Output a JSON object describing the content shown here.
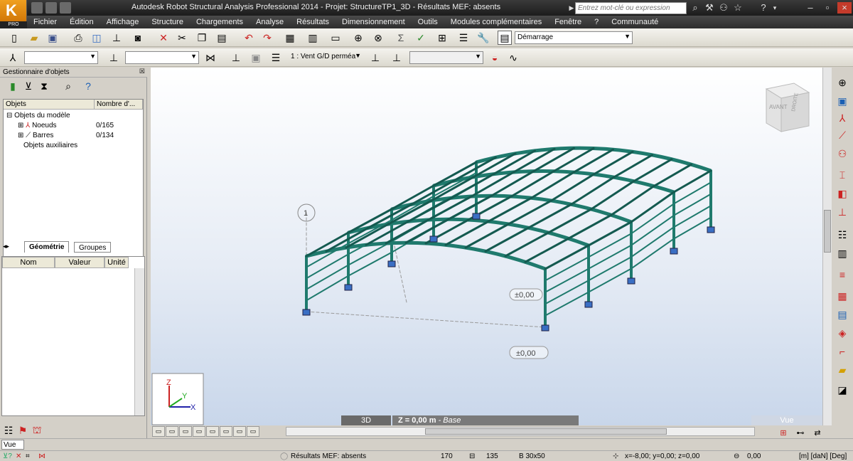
{
  "app": {
    "title": "Autodesk Robot Structural Analysis Professional 2014 - Projet: StructureTP1_3D - Résultats MEF: absents",
    "logo_letter": "K",
    "logo_badge": "PRO"
  },
  "search": {
    "placeholder": "Entrez mot-clé ou expression"
  },
  "menu": [
    "Fichier",
    "Édition",
    "Affichage",
    "Structure",
    "Chargements",
    "Analyse",
    "Résultats",
    "Dimensionnement",
    "Outils",
    "Modules complémentaires",
    "Fenêtre",
    "?",
    "Communauté"
  ],
  "toolbar1": {
    "layout_select": "Démarrage"
  },
  "toolbar2": {
    "case_select": "1 : Vent G/D perméa",
    "node_select": "",
    "bar_select": "",
    "extra_select": ""
  },
  "object_manager": {
    "title": "Gestionnaire d'objets",
    "col_objects": "Objets",
    "col_count": "Nombre d'...",
    "model_objects": "Objets du modèle",
    "nodes_label": "Noeuds",
    "nodes_count": "0/165",
    "bars_label": "Barres",
    "bars_count": "0/134",
    "aux_objects": "Objets auxiliaires",
    "tab_geometry": "Géométrie",
    "tab_groups": "Groupes"
  },
  "properties": {
    "col_name": "Nom",
    "col_value": "Valeur",
    "col_unit": "Unité"
  },
  "viewport": {
    "view_cube_front": "AVANT",
    "view_cube_right": "DROITE",
    "level_marker": "1",
    "elev_1": "±0,00",
    "elev_2": "±0,00",
    "elev_3": "±0,00",
    "axis_x": "X",
    "axis_y": "Y",
    "axis_z": "Z",
    "mode_3d": "3D",
    "plane_label": "Z = 0,00 m",
    "plane_name": "- Base",
    "view_tab": "Vue"
  },
  "vue_field": "Vue",
  "status": {
    "results": "Résultats MEF: absents",
    "nodes": "170",
    "bars": "135",
    "section": "B 30x50",
    "coords": "x=-8,00; y=0,00; z=0,00",
    "angle": "0,00",
    "units": "[m] [daN] [Deg]"
  },
  "colors": {
    "structure": "#1f7a6d",
    "structure_dark": "#145a50",
    "support": "#3a6fc4",
    "menubar": "#3a3a3a"
  }
}
